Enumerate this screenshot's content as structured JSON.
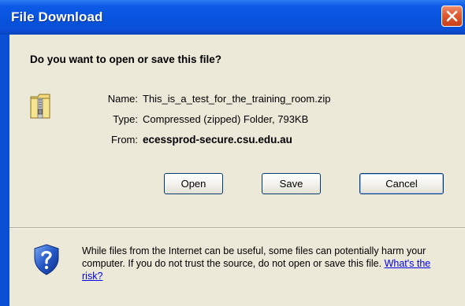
{
  "window": {
    "title": "File Download"
  },
  "dialog": {
    "question": "Do you want to open or save this file?",
    "fields": [
      {
        "label": "Name:",
        "value": "This_is_a_test_for_the_training_room.zip",
        "bold": false
      },
      {
        "label": "Type:",
        "value": "Compressed (zipped) Folder, 793KB",
        "bold": false
      },
      {
        "label": "From:",
        "value": "ecessprod-secure.csu.edu.au",
        "bold": true
      }
    ],
    "buttons": {
      "open": "Open",
      "save": "Save",
      "cancel": "Cancel"
    },
    "warning": {
      "text": "While files from the Internet can be useful, some files can potentially harm your computer. If you do not trust the source, do not open or save this file.",
      "link": "What's the risk?"
    }
  },
  "icons": {
    "close": "close-icon",
    "file": "zip-folder-icon",
    "security": "shield-question-icon"
  },
  "colors": {
    "titlebar": "#0753dd",
    "client": "#ece9d8",
    "close": "#e0592f",
    "link": "#0000ee"
  }
}
